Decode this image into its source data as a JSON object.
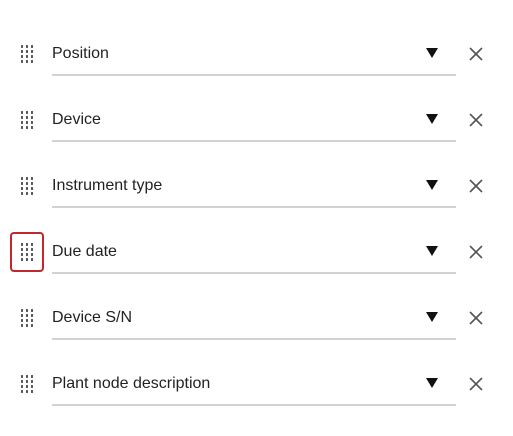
{
  "columns": [
    {
      "label": "Position",
      "focused": false
    },
    {
      "label": "Device",
      "focused": false
    },
    {
      "label": "Instrument type",
      "focused": false
    },
    {
      "label": "Due date",
      "focused": true
    },
    {
      "label": "Device S/N",
      "focused": false
    },
    {
      "label": "Plant node description",
      "focused": false
    }
  ],
  "colors": {
    "focus_ring": "#c0282d",
    "underline": "#d2d2d2",
    "icon": "#555555",
    "text": "#222222"
  },
  "icons": {
    "handle": "drag-handle-icon",
    "caret": "dropdown-caret-icon",
    "remove": "close-icon"
  }
}
